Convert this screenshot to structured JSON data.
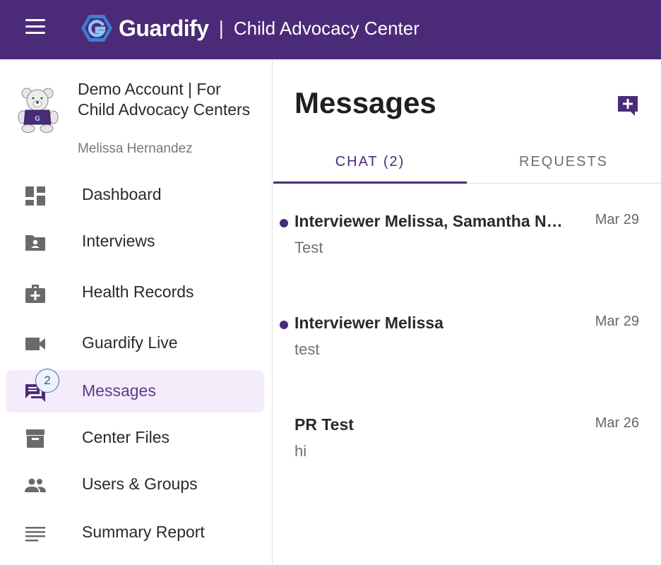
{
  "header": {
    "brand_name": "Guardify",
    "separator": "|",
    "subtitle": "Child Advocacy Center",
    "bar_color": "#4b2a78"
  },
  "account": {
    "name": "Demo Account | For Child Advocacy Centers",
    "user": "Melissa Hernandez"
  },
  "sidebar": {
    "items": [
      {
        "label": "Dashboard",
        "icon": "dashboard-icon"
      },
      {
        "label": "Interviews",
        "icon": "folder-person-icon"
      },
      {
        "label": "Health Records",
        "icon": "medical-bag-icon"
      },
      {
        "label": "Guardify Live",
        "icon": "video-camera-icon"
      },
      {
        "label": "Messages",
        "icon": "chat-icon",
        "badge": "2",
        "active": true
      },
      {
        "label": "Center Files",
        "icon": "archive-icon"
      },
      {
        "label": "Users & Groups",
        "icon": "people-icon"
      },
      {
        "label": "Summary Report",
        "icon": "lines-icon"
      }
    ]
  },
  "main": {
    "title": "Messages",
    "tabs": [
      {
        "label": "CHAT (2)",
        "active": true
      },
      {
        "label": "REQUESTS",
        "active": false
      }
    ],
    "threads": [
      {
        "title": "Interviewer Melissa, Samantha Nowak",
        "date": "Mar 29",
        "preview": "Test",
        "unread": true
      },
      {
        "title": "Interviewer Melissa",
        "date": "Mar 29",
        "preview": "test",
        "unread": true
      },
      {
        "title": "PR Test",
        "date": "Mar 26",
        "preview": "hi",
        "unread": false
      }
    ]
  }
}
